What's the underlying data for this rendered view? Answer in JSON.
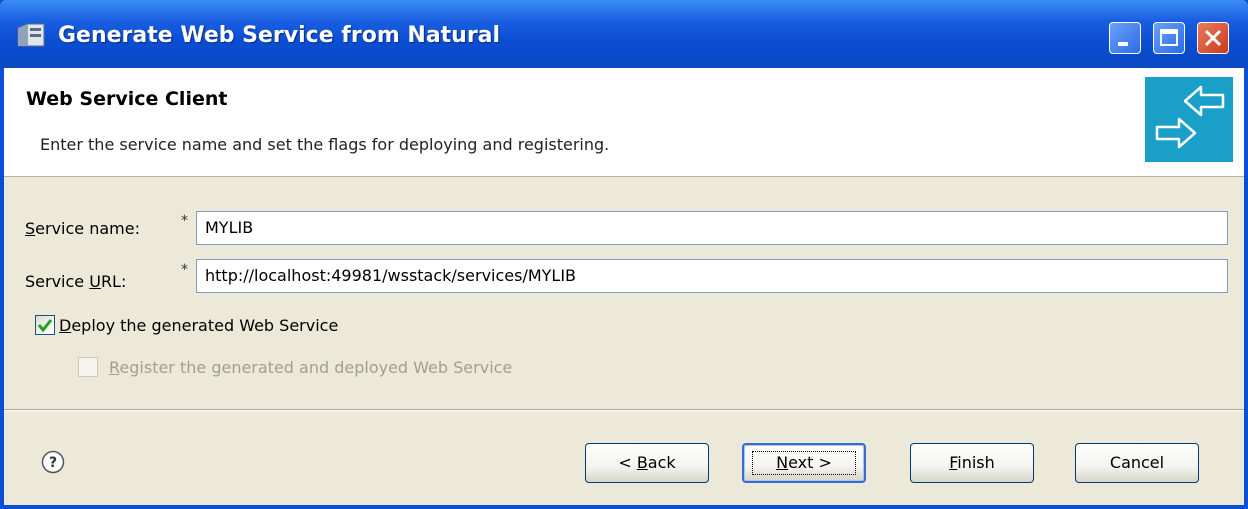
{
  "window": {
    "title": "Generate Web Service from Natural",
    "icon": "eclipse-wizard-icon"
  },
  "header": {
    "title": "Web Service Client",
    "description": "Enter the service name and set the flags for deploying and registering.",
    "banner_icon": "web-service-arrows-icon",
    "banner_color": "#1aa0c8"
  },
  "form": {
    "service_name": {
      "label_prefix": "",
      "label_mnemonic": "S",
      "label_rest": "ervice name:",
      "required_marker": "*",
      "value": "MYLIB"
    },
    "service_url": {
      "label_prefix": "Service ",
      "label_mnemonic": "U",
      "label_rest": "RL:",
      "required_marker": "*",
      "value": "http://localhost:49981/wsstack/services/MYLIB"
    },
    "deploy": {
      "label_prefix": "",
      "label_mnemonic": "D",
      "label_rest": "eploy the generated Web Service",
      "checked": true,
      "enabled": true
    },
    "register": {
      "label_prefix": "",
      "label_mnemonic": "R",
      "label_rest": "egister the generated and deployed Web Service",
      "checked": false,
      "enabled": false
    }
  },
  "footer": {
    "help_icon": "help-icon",
    "back": {
      "prefix": "< ",
      "mnemonic": "B",
      "rest": "ack"
    },
    "next": {
      "prefix": "",
      "mnemonic": "N",
      "rest": "ext >"
    },
    "finish": {
      "prefix": "",
      "mnemonic": "F",
      "rest": "inish"
    },
    "cancel": {
      "label": "Cancel"
    }
  }
}
